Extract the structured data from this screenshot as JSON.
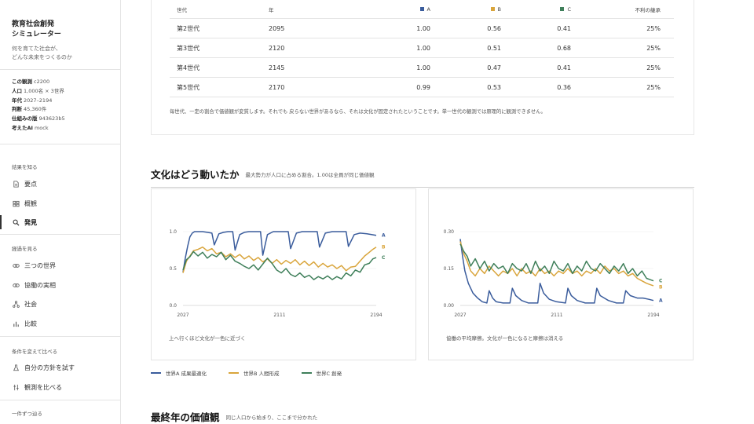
{
  "app": {
    "title_line1": "教育社会創発",
    "title_line2": "シミュレーター",
    "tagline_line1": "何を育てた社会が、",
    "tagline_line2": "どんな未来をつくるのか"
  },
  "meta": [
    {
      "key": "この観測",
      "value": "c2200"
    },
    {
      "key": "人口",
      "value": "1,000名 × 3世界"
    },
    {
      "key": "年代",
      "value": "2027–2194"
    },
    {
      "key": "判断",
      "value": "45,360件"
    },
    {
      "key": "仕組みの版",
      "value": "943623b5"
    },
    {
      "key": "考えたAI",
      "value": "mock"
    }
  ],
  "nav": {
    "section1": "結果を知る",
    "section2": "経過を見る",
    "section3": "条件を変えて比べる",
    "section4": "一件ずつ辿る",
    "items": [
      {
        "label": "要点",
        "icon": "document-icon"
      },
      {
        "label": "概観",
        "icon": "grid-icon"
      },
      {
        "label": "発見",
        "icon": "search-icon"
      },
      {
        "label": "三つの世界",
        "icon": "link-icon"
      },
      {
        "label": "協働の実相",
        "icon": "link-icon"
      },
      {
        "label": "社会",
        "icon": "network-icon"
      },
      {
        "label": "比較",
        "icon": "bar-chart-icon"
      },
      {
        "label": "自分の方針を試す",
        "icon": "flask-icon"
      },
      {
        "label": "観測を比べる",
        "icon": "columns-icon"
      }
    ]
  },
  "colors": {
    "A": "#3a5c9c",
    "B": "#d9a53c",
    "C": "#3f7f5a"
  },
  "table": {
    "headers": {
      "gen": "世代",
      "year": "年",
      "a": "A",
      "b": "B",
      "c": "C",
      "disadv": "不利の継承"
    },
    "rows": [
      {
        "gen": "第2世代",
        "year": "2095",
        "a": "1.00",
        "b": "0.56",
        "c": "0.41",
        "disadv": "25%"
      },
      {
        "gen": "第3世代",
        "year": "2120",
        "a": "1.00",
        "b": "0.51",
        "c": "0.68",
        "disadv": "25%"
      },
      {
        "gen": "第4世代",
        "year": "2145",
        "a": "1.00",
        "b": "0.47",
        "c": "0.41",
        "disadv": "25%"
      },
      {
        "gen": "第5世代",
        "year": "2170",
        "a": "0.99",
        "b": "0.53",
        "c": "0.36",
        "disadv": "25%"
      }
    ],
    "note": "毎世代、一定の割合で価値観が変質します。それでも 戻らない世界があるなら、それは文化が固定されたということです。単一世代の観測では原理的に観測できません。"
  },
  "culture": {
    "title": "文化はどう動いたか",
    "subtitle": "最大勢力が人口に占める割合。1.00は全員が同じ価値観"
  },
  "final": {
    "title": "最終年の価値観",
    "subtitle": "同じ人口から始まり、ここまで分かれた"
  },
  "legend": [
    {
      "key": "A",
      "label": "世界A 成果最適化"
    },
    {
      "key": "B",
      "label": "世界B 人間形成"
    },
    {
      "key": "C",
      "label": "世界C 創発"
    }
  ],
  "chart_data": [
    {
      "type": "line",
      "caption": "上へ行くほど文化が一色に近づく",
      "x_ticks": [
        "2027",
        "2111",
        "2194"
      ],
      "y_ticks": [
        "0.0",
        "0.5",
        "1.0"
      ],
      "xlim": [
        2027,
        2194
      ],
      "ylim": [
        0,
        1.0
      ],
      "series": [
        {
          "name": "A",
          "x": [
            2027,
            2029,
            2031,
            2033,
            2035,
            2037,
            2040,
            2044,
            2048,
            2052,
            2054,
            2058,
            2062,
            2066,
            2070,
            2072,
            2076,
            2080,
            2084,
            2088,
            2094,
            2096,
            2100,
            2105,
            2110,
            2118,
            2120,
            2125,
            2130,
            2135,
            2143,
            2145,
            2150,
            2156,
            2162,
            2168,
            2170,
            2175,
            2180,
            2186,
            2190,
            2194
          ],
          "y": [
            0.45,
            0.64,
            0.8,
            0.93,
            0.98,
            1.0,
            1.0,
            1.0,
            0.99,
            0.98,
            0.82,
            0.97,
            0.99,
            1.0,
            1.0,
            0.75,
            0.96,
            0.99,
            1.0,
            1.0,
            1.0,
            0.68,
            0.96,
            1.0,
            1.0,
            1.0,
            0.77,
            0.98,
            1.0,
            1.0,
            1.0,
            0.79,
            0.98,
            1.0,
            1.0,
            1.0,
            0.8,
            0.96,
            0.98,
            0.97,
            0.96,
            0.95
          ]
        },
        {
          "name": "B",
          "x": [
            2027,
            2030,
            2033,
            2036,
            2040,
            2044,
            2048,
            2052,
            2056,
            2060,
            2064,
            2068,
            2072,
            2076,
            2080,
            2084,
            2088,
            2092,
            2096,
            2100,
            2104,
            2108,
            2112,
            2116,
            2120,
            2124,
            2128,
            2132,
            2136,
            2140,
            2144,
            2148,
            2152,
            2156,
            2160,
            2164,
            2168,
            2172,
            2176,
            2180,
            2184,
            2188,
            2191,
            2194
          ],
          "y": [
            0.44,
            0.6,
            0.67,
            0.74,
            0.76,
            0.79,
            0.74,
            0.77,
            0.7,
            0.72,
            0.66,
            0.7,
            0.65,
            0.69,
            0.63,
            0.67,
            0.61,
            0.65,
            0.59,
            0.63,
            0.57,
            0.62,
            0.56,
            0.61,
            0.57,
            0.62,
            0.55,
            0.6,
            0.54,
            0.59,
            0.52,
            0.57,
            0.52,
            0.55,
            0.5,
            0.54,
            0.47,
            0.52,
            0.53,
            0.6,
            0.67,
            0.72,
            0.76,
            0.79
          ]
        },
        {
          "name": "C",
          "x": [
            2027,
            2030,
            2033,
            2036,
            2040,
            2044,
            2048,
            2052,
            2056,
            2060,
            2064,
            2068,
            2072,
            2076,
            2080,
            2084,
            2088,
            2092,
            2096,
            2100,
            2104,
            2108,
            2112,
            2116,
            2120,
            2124,
            2128,
            2132,
            2136,
            2140,
            2144,
            2148,
            2152,
            2156,
            2160,
            2164,
            2168,
            2172,
            2176,
            2180,
            2184,
            2188,
            2191,
            2194
          ],
          "y": [
            0.48,
            0.62,
            0.66,
            0.73,
            0.67,
            0.72,
            0.64,
            0.69,
            0.66,
            0.72,
            0.62,
            0.68,
            0.6,
            0.57,
            0.53,
            0.5,
            0.55,
            0.48,
            0.56,
            0.64,
            0.57,
            0.48,
            0.44,
            0.5,
            0.42,
            0.39,
            0.44,
            0.38,
            0.41,
            0.35,
            0.39,
            0.36,
            0.4,
            0.35,
            0.39,
            0.36,
            0.44,
            0.4,
            0.48,
            0.45,
            0.55,
            0.57,
            0.63,
            0.65
          ]
        }
      ]
    },
    {
      "type": "line",
      "caption": "協働の平均摩擦。文化が一色になると摩擦は消える",
      "x_ticks": [
        "2027",
        "2111",
        "2194"
      ],
      "y_ticks": [
        "0.00",
        "0.15",
        "0.30"
      ],
      "xlim": [
        2027,
        2194
      ],
      "ylim": [
        0,
        0.3
      ],
      "series": [
        {
          "name": "A",
          "x": [
            2027,
            2029,
            2031,
            2034,
            2038,
            2042,
            2046,
            2050,
            2052,
            2055,
            2058,
            2064,
            2070,
            2072,
            2075,
            2080,
            2086,
            2094,
            2096,
            2099,
            2104,
            2110,
            2118,
            2120,
            2123,
            2128,
            2135,
            2143,
            2145,
            2148,
            2155,
            2162,
            2168,
            2170,
            2174,
            2180,
            2185,
            2190,
            2194
          ],
          "y": [
            0.27,
            0.2,
            0.14,
            0.09,
            0.05,
            0.03,
            0.015,
            0.01,
            0.06,
            0.03,
            0.015,
            0.01,
            0.01,
            0.07,
            0.04,
            0.02,
            0.01,
            0.01,
            0.09,
            0.05,
            0.025,
            0.015,
            0.01,
            0.07,
            0.04,
            0.02,
            0.01,
            0.01,
            0.07,
            0.04,
            0.02,
            0.01,
            0.01,
            0.06,
            0.04,
            0.03,
            0.03,
            0.025,
            0.02
          ]
        },
        {
          "name": "B",
          "x": [
            2027,
            2030,
            2033,
            2036,
            2040,
            2044,
            2048,
            2052,
            2056,
            2060,
            2064,
            2068,
            2072,
            2076,
            2080,
            2084,
            2088,
            2092,
            2096,
            2100,
            2104,
            2108,
            2112,
            2116,
            2120,
            2124,
            2128,
            2132,
            2136,
            2140,
            2144,
            2148,
            2152,
            2156,
            2160,
            2164,
            2168,
            2172,
            2176,
            2180,
            2184,
            2188,
            2191,
            2194
          ],
          "y": [
            0.26,
            0.21,
            0.18,
            0.14,
            0.12,
            0.15,
            0.13,
            0.16,
            0.14,
            0.12,
            0.14,
            0.13,
            0.15,
            0.12,
            0.15,
            0.13,
            0.14,
            0.12,
            0.15,
            0.13,
            0.14,
            0.12,
            0.14,
            0.13,
            0.15,
            0.13,
            0.14,
            0.12,
            0.14,
            0.13,
            0.15,
            0.13,
            0.16,
            0.14,
            0.15,
            0.13,
            0.14,
            0.12,
            0.13,
            0.11,
            0.1,
            0.09,
            0.085,
            0.08
          ]
        },
        {
          "name": "C",
          "x": [
            2027,
            2030,
            2033,
            2036,
            2040,
            2044,
            2048,
            2052,
            2056,
            2060,
            2064,
            2068,
            2072,
            2076,
            2080,
            2084,
            2088,
            2092,
            2096,
            2100,
            2104,
            2108,
            2112,
            2116,
            2120,
            2124,
            2128,
            2132,
            2136,
            2140,
            2144,
            2148,
            2152,
            2156,
            2160,
            2164,
            2168,
            2172,
            2176,
            2180,
            2184,
            2188,
            2191,
            2194
          ],
          "y": [
            0.25,
            0.22,
            0.2,
            0.16,
            0.19,
            0.15,
            0.18,
            0.14,
            0.17,
            0.15,
            0.16,
            0.13,
            0.17,
            0.15,
            0.14,
            0.17,
            0.13,
            0.18,
            0.14,
            0.16,
            0.13,
            0.18,
            0.15,
            0.14,
            0.17,
            0.13,
            0.16,
            0.14,
            0.18,
            0.15,
            0.14,
            0.17,
            0.15,
            0.13,
            0.16,
            0.14,
            0.17,
            0.13,
            0.15,
            0.12,
            0.14,
            0.11,
            0.105,
            0.1
          ]
        }
      ]
    }
  ]
}
